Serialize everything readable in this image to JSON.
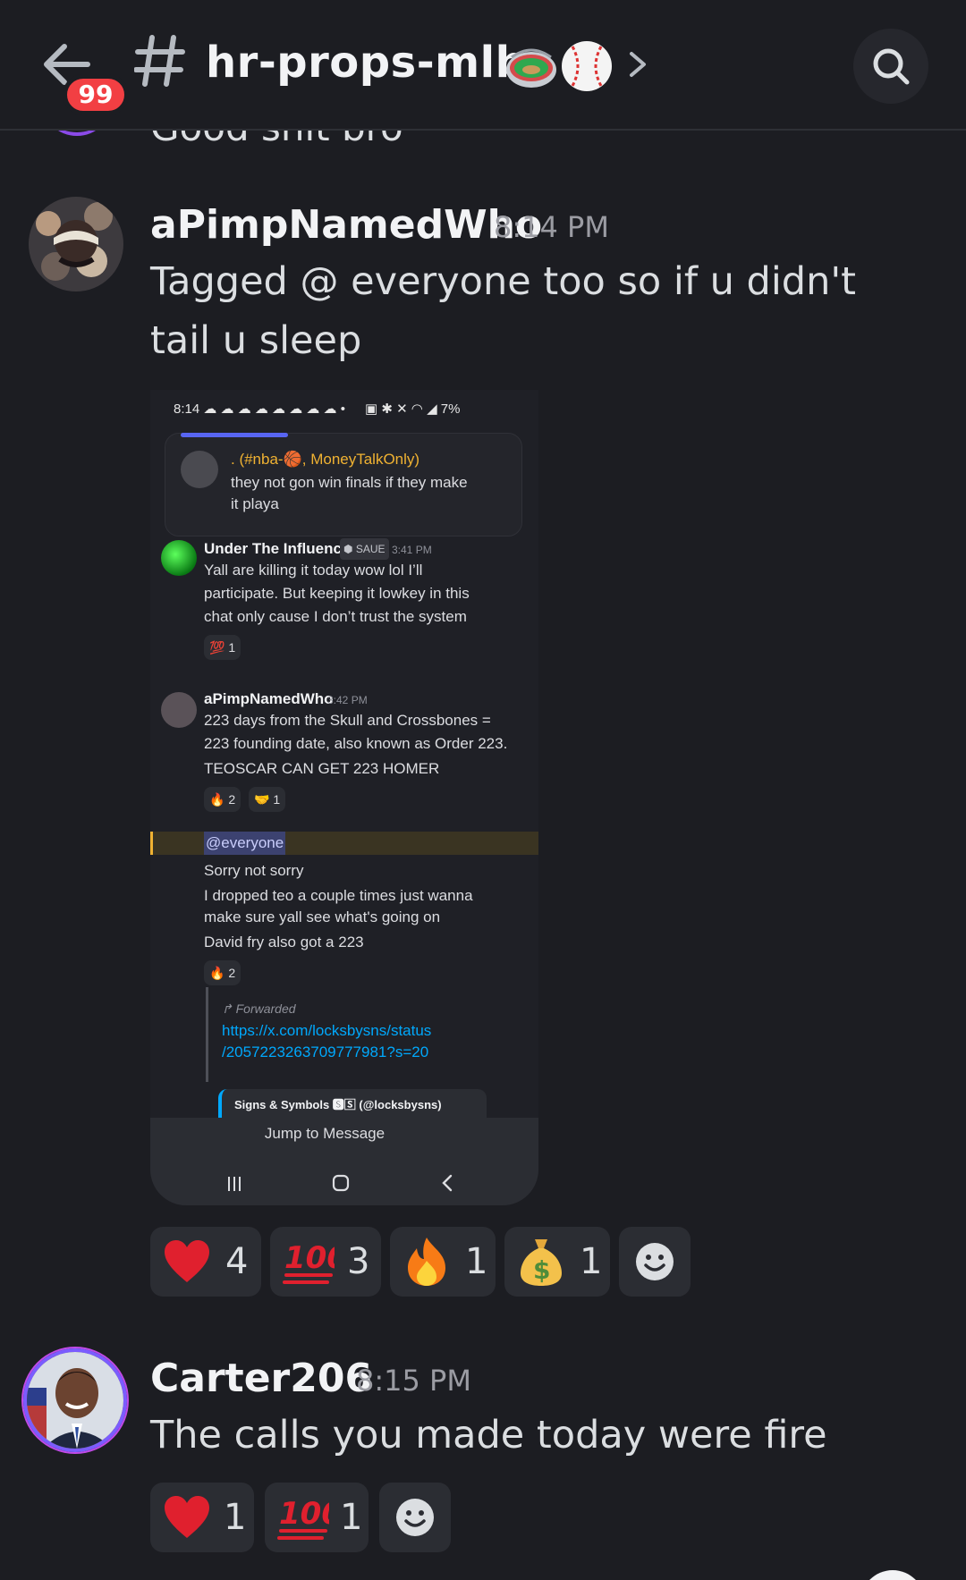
{
  "header": {
    "unread_count": "99",
    "channel_name": "hr-props-mlb-"
  },
  "previous_message": {
    "text": "Good shit bro"
  },
  "messages": [
    {
      "author": "aPimpNamedWho",
      "time": "8:14 PM",
      "text": "Tagged @ everyone too so if u didn't tail u sleep",
      "reactions": [
        {
          "icon": "heart",
          "count": "4"
        },
        {
          "icon": "hundred",
          "count": "3"
        },
        {
          "icon": "fire",
          "count": "1"
        },
        {
          "icon": "money-bag",
          "count": "1"
        }
      ]
    },
    {
      "author": "Carter206",
      "time": "8:15 PM",
      "text": "The calls you made today were fire",
      "reactions": [
        {
          "icon": "heart",
          "count": "1"
        },
        {
          "icon": "hundred",
          "count": "1"
        }
      ]
    }
  ],
  "screenshot": {
    "status_time": "8:14",
    "status_battery": "7%",
    "reply_card": {
      "context": ". (#nba-🏀, MoneyTalkOnly)",
      "line1": "they not gon win finals if they make",
      "line2": "it playa"
    },
    "msg1": {
      "author": "Under The Influence",
      "tag": "SAUE",
      "time": "3:41 PM",
      "lines": [
        "Yall are killing it today wow lol I’ll",
        "participate. But keeping it lowkey in this",
        "chat only cause I don’t trust the system"
      ],
      "reaction": "💯 1"
    },
    "msg2": {
      "author": "aPimpNamedWho",
      "time": "3:42 PM",
      "lines": [
        "223 days from the Skull and Crossbones =",
        "223 founding date, also known as Order 223.",
        "TEOSCAR CAN GET 223 HOMER"
      ],
      "reaction_a": "🔥 2",
      "reaction_b": "🤝 1"
    },
    "msg3": {
      "mention": "@everyone",
      "lines": [
        "Sorry not sorry",
        "I dropped teo a couple times just wanna",
        "make sure yall see what's going on",
        "David fry also got a 223"
      ],
      "reaction": "🔥 2"
    },
    "forward": {
      "label": "Forwarded",
      "link1": "https://x.com/locksbysns/status",
      "link2": "/2057223263709777981?s=20",
      "embed": "Signs & Symbols 🆂🅂 (@locksbysns)"
    },
    "jump_label": "Jump to Message"
  },
  "colors": {
    "background": "#1c1d22",
    "badge": "#f23f43",
    "link": "#00a8fc",
    "mention_bg": "#3c4270"
  }
}
